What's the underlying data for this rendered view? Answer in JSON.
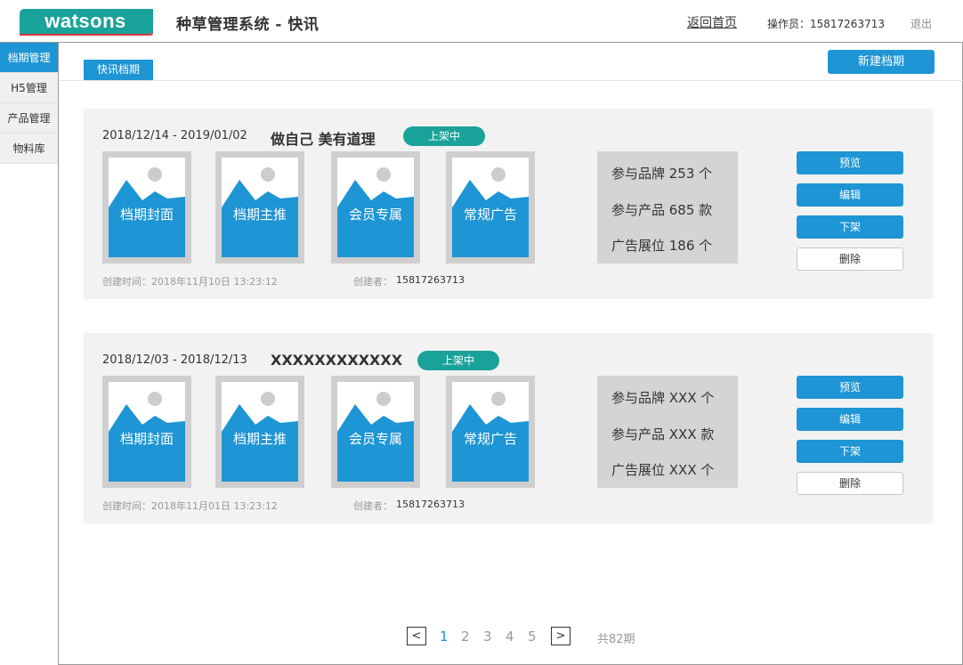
{
  "colors": {
    "brand_green": "#1aa39a",
    "accent_blue": "#1e95d4",
    "status_green": "#19a29a"
  },
  "header": {
    "logo_text": "watsons",
    "title": "种草管理系统 - 快讯",
    "back_home": "返回首页",
    "operator": "操作员：15817263713",
    "logout": "退出"
  },
  "sidebar": {
    "items": [
      {
        "label": "档期管理",
        "active": true
      },
      {
        "label": "H5管理"
      },
      {
        "label": "产品管理"
      },
      {
        "label": "物料库"
      }
    ]
  },
  "main": {
    "tab_label": "快讯档期",
    "new_button": "新建档期",
    "cards": [
      {
        "date_range": "2018/12/14 - 2019/01/02",
        "title": "做自己 美有道理",
        "status": "上架中",
        "thumbs": [
          "档期封面",
          "档期主推",
          "会员专属",
          "常规广告"
        ],
        "stats": [
          "参与品牌 253 个",
          "参与产品 685 款",
          "广告展位 186 个"
        ],
        "actions": {
          "preview": "预览",
          "edit": "编辑",
          "unpublish": "下架",
          "delete": "删除"
        },
        "created_time": "创建时间：2018年11月10日 13:23:12",
        "creator_label": "创建者：",
        "creator": "15817263713"
      },
      {
        "date_range": "2018/12/03 - 2018/12/13",
        "title": "XXXXXXXXXXXX",
        "status": "上架中",
        "thumbs": [
          "档期封面",
          "档期主推",
          "会员专属",
          "常规广告"
        ],
        "stats": [
          "参与品牌 XXX 个",
          "参与产品 XXX 款",
          "广告展位 XXX 个"
        ],
        "actions": {
          "preview": "预览",
          "edit": "编辑",
          "unpublish": "下架",
          "delete": "删除"
        },
        "created_time": "创建时间：2018年11月01日 13:23:12",
        "creator_label": "创建者：",
        "creator": "15817263713"
      }
    ]
  },
  "pagination": {
    "prev": "<",
    "next": ">",
    "pages": [
      "1",
      "2",
      "3",
      "4",
      "5"
    ],
    "current": "1",
    "total": "共82期"
  }
}
